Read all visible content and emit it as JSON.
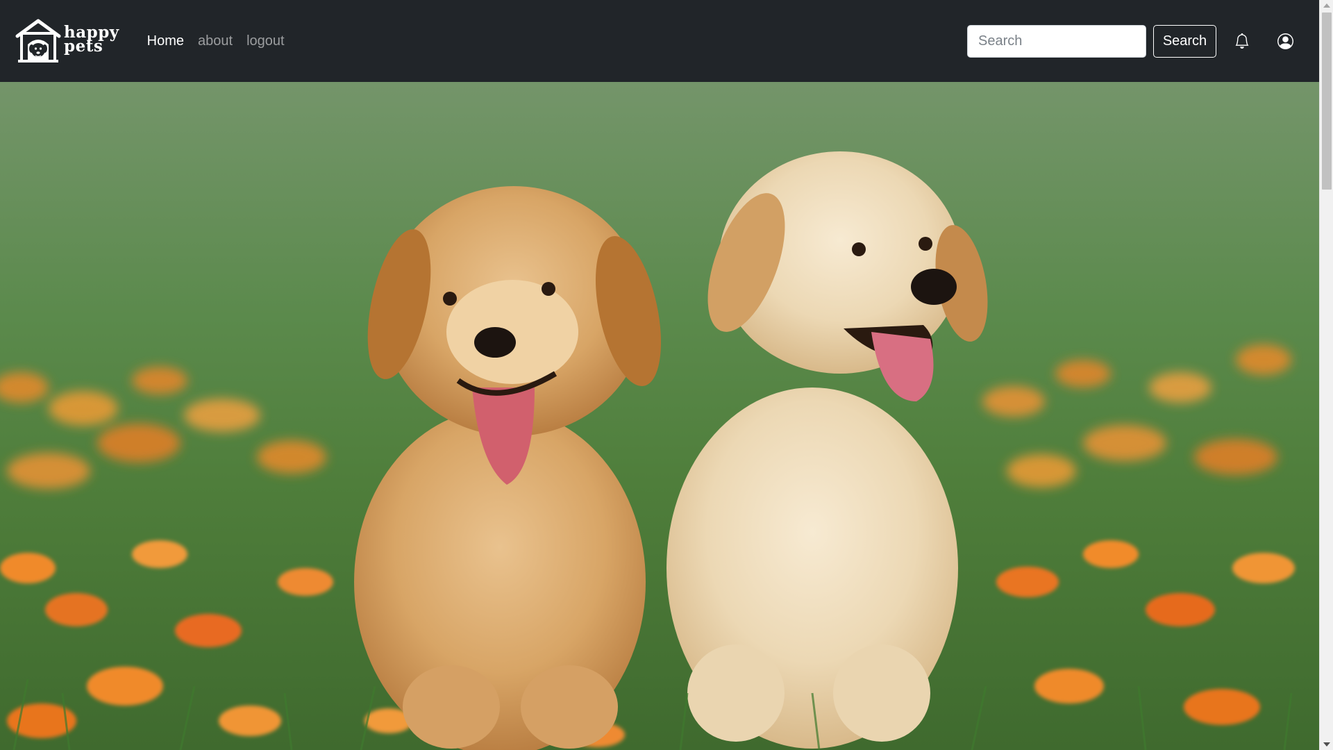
{
  "brand": {
    "logo_icon": "doghouse-dog-icon",
    "line1": "happy",
    "line2": "pets"
  },
  "nav": {
    "links": [
      {
        "label": "Home",
        "active": true
      },
      {
        "label": "about",
        "active": false
      },
      {
        "label": "logout",
        "active": false
      }
    ]
  },
  "search": {
    "placeholder": "Search",
    "value": "",
    "button_label": "Search"
  },
  "icons": {
    "notifications": "bell-icon",
    "account": "user-circle-icon"
  },
  "hero": {
    "image": "two-golden-retriever-puppies-in-grass-with-orange-flowers"
  },
  "colors": {
    "navbar_bg": "#212529",
    "link_active": "#ffffff",
    "link_muted": "rgba(255,255,255,0.55)"
  }
}
